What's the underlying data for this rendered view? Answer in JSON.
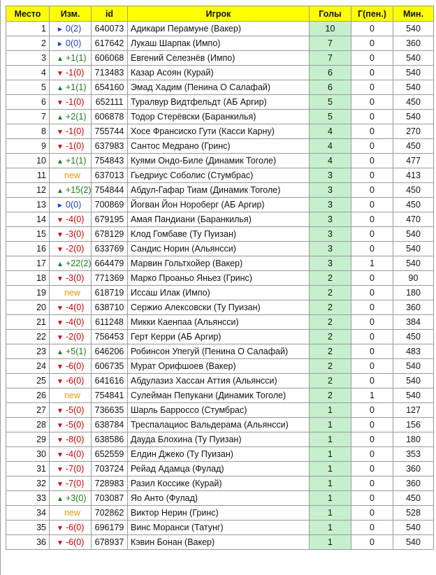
{
  "headers": {
    "place": "Место",
    "change": "Изм.",
    "id": "id",
    "player": "Игрок",
    "goals": "Голы",
    "pen": "Г(пен.)",
    "min": "Мин."
  },
  "colors": {
    "header_bg": "#ffff00",
    "goals_bg": "#c6efce",
    "up": "#1a7a1a",
    "down": "#d00000",
    "same": "#1f3ad6",
    "new": "#e69a00"
  },
  "icons": {
    "up": "triangle-up-icon",
    "down": "triangle-down-icon",
    "same": "triangle-right-icon"
  },
  "rows": [
    {
      "place": "1",
      "dir": "same",
      "change": "0(2)",
      "id": "640073",
      "player": "Адикари Перамуне (Вакер)",
      "goals": "10",
      "pen": "0",
      "min": "540"
    },
    {
      "place": "2",
      "dir": "same",
      "change": "0(0)",
      "id": "617642",
      "player": "Лукаш Шарпак (Импо)",
      "goals": "7",
      "pen": "0",
      "min": "360"
    },
    {
      "place": "3",
      "dir": "up",
      "change": "+1(1)",
      "id": "606068",
      "player": "Евгений Селезнёв (Импо)",
      "goals": "7",
      "pen": "0",
      "min": "540"
    },
    {
      "place": "4",
      "dir": "down",
      "change": "-1(0)",
      "id": "713483",
      "player": "Казар Асоян (Курай)",
      "goals": "6",
      "pen": "0",
      "min": "540"
    },
    {
      "place": "5",
      "dir": "up",
      "change": "+1(1)",
      "id": "654160",
      "player": "Эмад Хадим (Пенина О Салафай)",
      "goals": "6",
      "pen": "0",
      "min": "540"
    },
    {
      "place": "6",
      "dir": "down",
      "change": "-1(0)",
      "id": "652111",
      "player": "Туралвур Видтфельдт (АБ Аргир)",
      "goals": "5",
      "pen": "0",
      "min": "450"
    },
    {
      "place": "7",
      "dir": "up",
      "change": "+2(1)",
      "id": "606878",
      "player": "Тодор Стерёвски (Баранкилья)",
      "goals": "5",
      "pen": "0",
      "min": "540"
    },
    {
      "place": "8",
      "dir": "down",
      "change": "-1(0)",
      "id": "755744",
      "player": "Хосе Франсиско Гути (Касси Карну)",
      "goals": "4",
      "pen": "0",
      "min": "270"
    },
    {
      "place": "9",
      "dir": "down",
      "change": "-1(0)",
      "id": "637983",
      "player": "Сантос Медрано (Гринс)",
      "goals": "4",
      "pen": "0",
      "min": "450"
    },
    {
      "place": "10",
      "dir": "up",
      "change": "+1(1)",
      "id": "754843",
      "player": "Куями Ондо-Биле (Динамик Тоголе)",
      "goals": "4",
      "pen": "0",
      "min": "477"
    },
    {
      "place": "11",
      "dir": "new",
      "change": "new",
      "id": "637013",
      "player": "Гьедриус Соболис (Стумбрас)",
      "goals": "3",
      "pen": "0",
      "min": "413"
    },
    {
      "place": "12",
      "dir": "up",
      "change": "+15(2)",
      "id": "754844",
      "player": "Абдул-Гафар Тиам (Динамик Тоголе)",
      "goals": "3",
      "pen": "0",
      "min": "450"
    },
    {
      "place": "13",
      "dir": "same",
      "change": "0(0)",
      "id": "700869",
      "player": "Йогван Йон Норoберг (АБ Аргир)",
      "goals": "3",
      "pen": "0",
      "min": "450"
    },
    {
      "place": "14",
      "dir": "down",
      "change": "-4(0)",
      "id": "679195",
      "player": "Амая Пандиани (Баранкилья)",
      "goals": "3",
      "pen": "0",
      "min": "470"
    },
    {
      "place": "15",
      "dir": "down",
      "change": "-3(0)",
      "id": "678129",
      "player": "Клод Гомбаве (Ту Пуизан)",
      "goals": "3",
      "pen": "0",
      "min": "540"
    },
    {
      "place": "16",
      "dir": "down",
      "change": "-2(0)",
      "id": "633769",
      "player": "Сандис Норин (Альянсси)",
      "goals": "3",
      "pen": "0",
      "min": "540"
    },
    {
      "place": "17",
      "dir": "up",
      "change": "+22(2)",
      "id": "664479",
      "player": "Марвин Гольтхойер (Вакер)",
      "goals": "3",
      "pen": "1",
      "min": "540"
    },
    {
      "place": "18",
      "dir": "down",
      "change": "-3(0)",
      "id": "771369",
      "player": "Марко Проаньо Яньез (Гринс)",
      "goals": "2",
      "pen": "0",
      "min": "90"
    },
    {
      "place": "19",
      "dir": "new",
      "change": "new",
      "id": "618719",
      "player": "Иссаш Илак (Импо)",
      "goals": "2",
      "pen": "0",
      "min": "180"
    },
    {
      "place": "20",
      "dir": "down",
      "change": "-4(0)",
      "id": "638710",
      "player": "Сержио Алексовски (Ту Пуизан)",
      "goals": "2",
      "pen": "0",
      "min": "360"
    },
    {
      "place": "21",
      "dir": "down",
      "change": "-4(0)",
      "id": "611248",
      "player": "Микки Каенпаа (Альянсси)",
      "goals": "2",
      "pen": "0",
      "min": "384"
    },
    {
      "place": "22",
      "dir": "down",
      "change": "-2(0)",
      "id": "756453",
      "player": "Герт Керри (АБ Аргир)",
      "goals": "2",
      "pen": "0",
      "min": "450"
    },
    {
      "place": "23",
      "dir": "up",
      "change": "+5(1)",
      "id": "646206",
      "player": "Робинсон Упегуй (Пенина О Салафай)",
      "goals": "2",
      "pen": "0",
      "min": "483"
    },
    {
      "place": "24",
      "dir": "down",
      "change": "-6(0)",
      "id": "606735",
      "player": "Мурат Орифшоев (Вакер)",
      "goals": "2",
      "pen": "0",
      "min": "540"
    },
    {
      "place": "25",
      "dir": "down",
      "change": "-6(0)",
      "id": "641616",
      "player": "Абдулазиз Хассан Аттия (Альянсси)",
      "goals": "2",
      "pen": "0",
      "min": "540"
    },
    {
      "place": "26",
      "dir": "new",
      "change": "new",
      "id": "754841",
      "player": "Сулейман Пепукани (Динамик Тоголе)",
      "goals": "2",
      "pen": "1",
      "min": "540"
    },
    {
      "place": "27",
      "dir": "down",
      "change": "-5(0)",
      "id": "736635",
      "player": "Шарль Барроссо (Стумбрас)",
      "goals": "1",
      "pen": "0",
      "min": "127"
    },
    {
      "place": "28",
      "dir": "down",
      "change": "-5(0)",
      "id": "638784",
      "player": "Треспалациос Вальдерама (Альянсси)",
      "goals": "1",
      "pen": "0",
      "min": "156"
    },
    {
      "place": "29",
      "dir": "down",
      "change": "-8(0)",
      "id": "638586",
      "player": "Дауда Блохина (Ту Пуизан)",
      "goals": "1",
      "pen": "0",
      "min": "180"
    },
    {
      "place": "30",
      "dir": "down",
      "change": "-4(0)",
      "id": "652559",
      "player": "Елдин Джеко (Ту Пуизан)",
      "goals": "1",
      "pen": "0",
      "min": "353"
    },
    {
      "place": "31",
      "dir": "down",
      "change": "-7(0)",
      "id": "703724",
      "player": "Рейад Адамца (Фулад)",
      "goals": "1",
      "pen": "0",
      "min": "360"
    },
    {
      "place": "32",
      "dir": "down",
      "change": "-7(0)",
      "id": "728983",
      "player": "Разил Коссике (Курай)",
      "goals": "1",
      "pen": "0",
      "min": "360"
    },
    {
      "place": "33",
      "dir": "up",
      "change": "+3(0)",
      "id": "703087",
      "player": "Яо Анто (Фулад)",
      "goals": "1",
      "pen": "0",
      "min": "450"
    },
    {
      "place": "34",
      "dir": "new",
      "change": "new",
      "id": "702862",
      "player": "Виктор Нерин (Гринс)",
      "goals": "1",
      "pen": "0",
      "min": "528"
    },
    {
      "place": "35",
      "dir": "down",
      "change": "-6(0)",
      "id": "696179",
      "player": "Винс Моранси (Татунг)",
      "goals": "1",
      "pen": "0",
      "min": "540"
    },
    {
      "place": "36",
      "dir": "down",
      "change": "-6(0)",
      "id": "678937",
      "player": "Кэвин Бонан (Вакер)",
      "goals": "1",
      "pen": "0",
      "min": "540"
    }
  ]
}
